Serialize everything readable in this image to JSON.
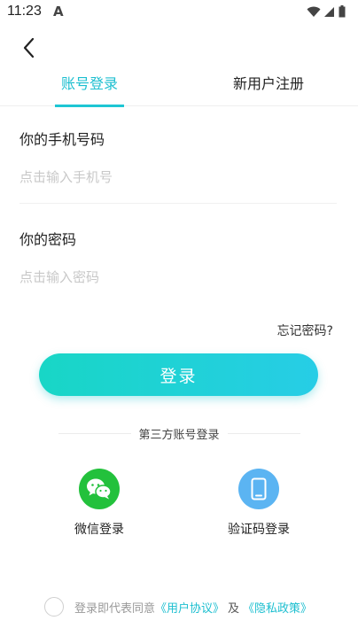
{
  "status_bar": {
    "time": "11:23",
    "notification_icon": "A"
  },
  "header": {
    "back_icon": "chevron-left"
  },
  "tabs": [
    {
      "label": "账号登录",
      "active": true
    },
    {
      "label": "新用户注册",
      "active": false
    }
  ],
  "form": {
    "phone": {
      "label": "你的手机号码",
      "placeholder": "点击输入手机号",
      "value": ""
    },
    "password": {
      "label": "你的密码",
      "placeholder": "点击输入密码",
      "value": ""
    },
    "forgot_label": "忘记密码?"
  },
  "login_button": {
    "label": "登录"
  },
  "third_party": {
    "title": "第三方账号登录",
    "options": [
      {
        "label": "微信登录",
        "icon": "wechat-icon",
        "color": "#23c13c"
      },
      {
        "label": "验证码登录",
        "icon": "phone-icon",
        "color": "#5bb4f2"
      }
    ]
  },
  "agreement": {
    "prefix": "登录即代表同意",
    "user_agreement": "《用户协议》",
    "and": "及",
    "privacy_policy": "《隐私政策》",
    "checked": false
  },
  "colors": {
    "accent": "#1dc6d4",
    "wechat": "#23c13c",
    "sms": "#5bb4f2"
  }
}
